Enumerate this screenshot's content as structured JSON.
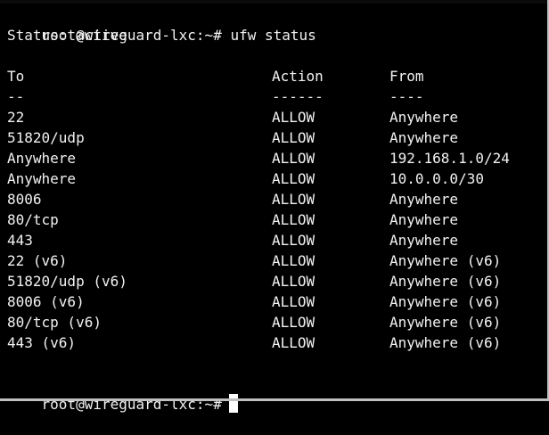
{
  "terminal": {
    "prompt": "root@wireguard-lxc:~#",
    "command": "ufw status",
    "status_line": "Status: active",
    "headers": {
      "to": "To",
      "action": "Action",
      "from": "From"
    },
    "separators": {
      "to": "--",
      "action": "------",
      "from": "----"
    },
    "rules": [
      {
        "to": "22",
        "action": "ALLOW",
        "from": "Anywhere"
      },
      {
        "to": "51820/udp",
        "action": "ALLOW",
        "from": "Anywhere"
      },
      {
        "to": "Anywhere",
        "action": "ALLOW",
        "from": "192.168.1.0/24"
      },
      {
        "to": "Anywhere",
        "action": "ALLOW",
        "from": "10.0.0.0/30"
      },
      {
        "to": "8006",
        "action": "ALLOW",
        "from": "Anywhere"
      },
      {
        "to": "80/tcp",
        "action": "ALLOW",
        "from": "Anywhere"
      },
      {
        "to": "443",
        "action": "ALLOW",
        "from": "Anywhere"
      },
      {
        "to": "22 (v6)",
        "action": "ALLOW",
        "from": "Anywhere (v6)"
      },
      {
        "to": "51820/udp (v6)",
        "action": "ALLOW",
        "from": "Anywhere (v6)"
      },
      {
        "to": "8006 (v6)",
        "action": "ALLOW",
        "from": "Anywhere (v6)"
      },
      {
        "to": "80/tcp (v6)",
        "action": "ALLOW",
        "from": "Anywhere (v6)"
      },
      {
        "to": "443 (v6)",
        "action": "ALLOW",
        "from": "Anywhere (v6)"
      }
    ],
    "final_prompt": "root@wireguard-lxc:~#"
  },
  "colors": {
    "background": "#000000",
    "foreground": "#f2f2f2",
    "cursor": "#ffffff"
  }
}
